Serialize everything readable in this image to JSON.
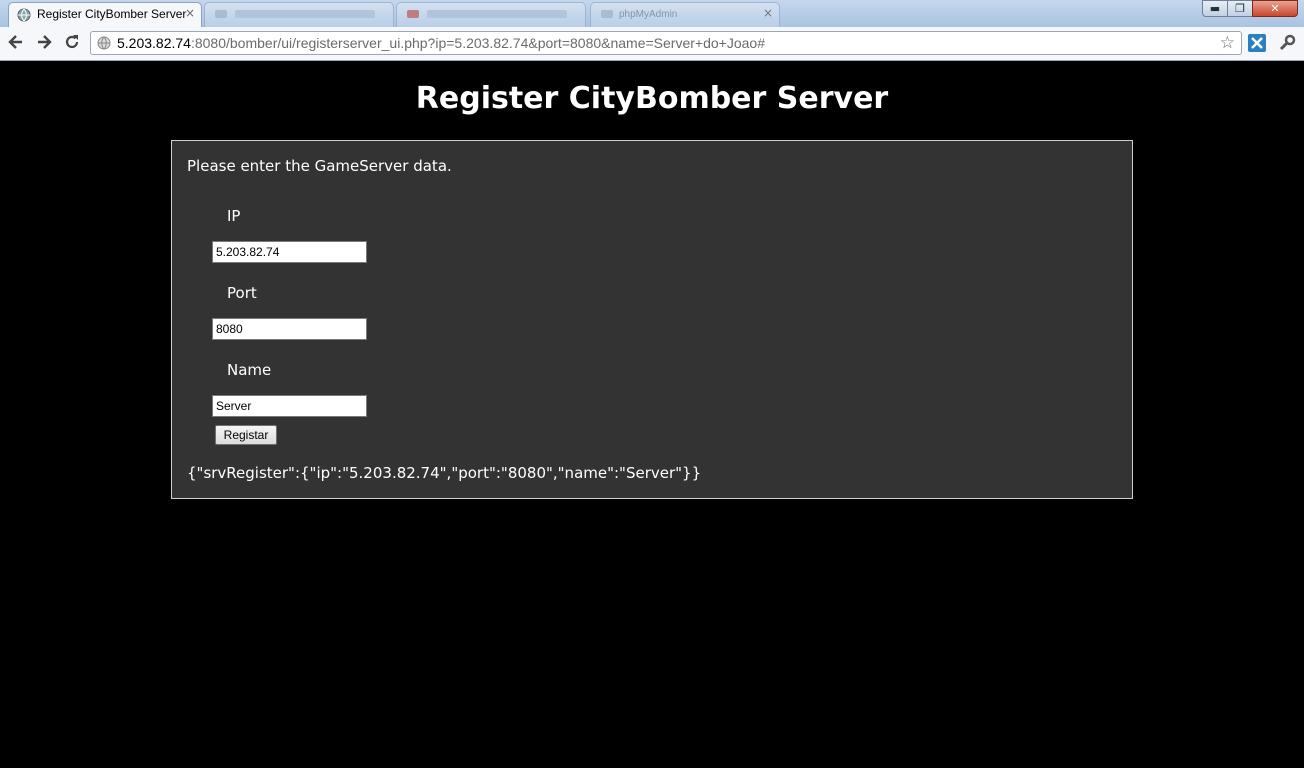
{
  "browser": {
    "tabs": [
      {
        "title": "Register CityBomber Server",
        "close": "×"
      },
      {
        "title": "",
        "close": ""
      },
      {
        "title": "",
        "close": ""
      },
      {
        "title": "phpMyAdmin",
        "close": "×"
      }
    ],
    "window_controls": {
      "minimize": "▬",
      "restore": "❐",
      "close": "✕"
    },
    "address": {
      "host": "5.203.82.74",
      "path": ":8080/bomber/ui/registerserver_ui.php?ip=5.203.82.74&port=8080&name=Server+do+Joao#"
    },
    "icons": {
      "back": "back-arrow-icon",
      "forward": "forward-arrow-icon",
      "reload": "reload-icon",
      "star": "bookmark-star-icon",
      "wrench": "wrench-icon"
    }
  },
  "page": {
    "title": "Register CityBomber Server",
    "intro": "Please enter the GameServer data.",
    "fields": {
      "ip": {
        "label": "IP",
        "value": "5.203.82.74"
      },
      "port": {
        "label": "Port",
        "value": "8080"
      },
      "name": {
        "label": "Name",
        "value": "Server"
      }
    },
    "submit_label": "Registar",
    "result": "{\"srvRegister\":{\"ip\":\"5.203.82.74\",\"port\":\"8080\",\"name\":\"Server\"}}"
  },
  "colors": {
    "page_bg": "#000000",
    "panel_bg": "#333333",
    "panel_border": "#cfcfcf",
    "text": "#ffffff"
  }
}
